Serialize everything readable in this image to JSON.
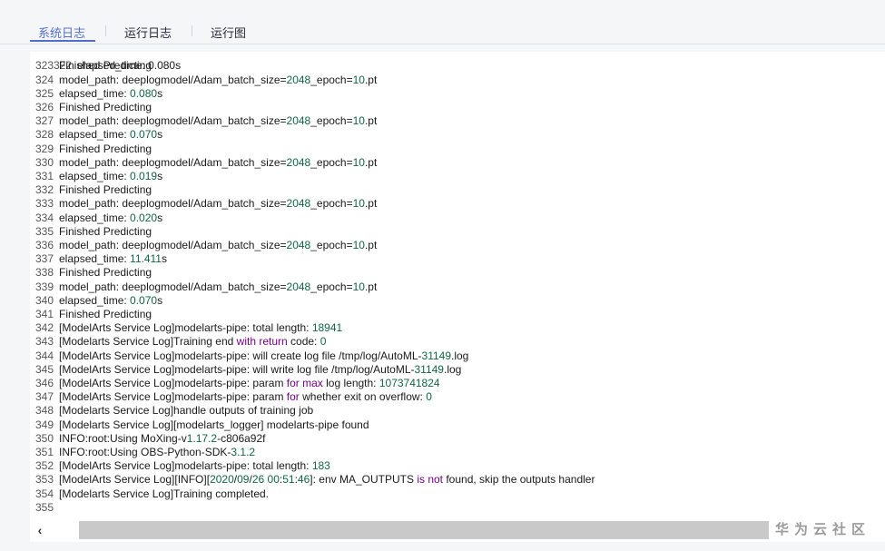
{
  "tabs": [
    {
      "label": "系统日志",
      "active": true
    },
    {
      "label": "运行日志",
      "active": false
    },
    {
      "label": "运行图",
      "active": false
    }
  ],
  "log": {
    "partial_top_line": "elapsed_time: 0.080s",
    "lines": [
      {
        "n": "323",
        "segs": [
          [
            "t",
            "Finished Predicting"
          ]
        ]
      },
      {
        "n": "324",
        "segs": [
          [
            "t",
            "model_path: deeplogmodel/Adam_batch_size="
          ],
          [
            "n",
            "2048"
          ],
          [
            "t",
            "_epoch="
          ],
          [
            "n",
            "10"
          ],
          [
            "t",
            ".pt"
          ]
        ]
      },
      {
        "n": "325",
        "segs": [
          [
            "t",
            "elapsed_time: "
          ],
          [
            "n",
            "0.080"
          ],
          [
            "t",
            "s"
          ]
        ]
      },
      {
        "n": "326",
        "segs": [
          [
            "t",
            "Finished Predicting"
          ]
        ]
      },
      {
        "n": "327",
        "segs": [
          [
            "t",
            "model_path: deeplogmodel/Adam_batch_size="
          ],
          [
            "n",
            "2048"
          ],
          [
            "t",
            "_epoch="
          ],
          [
            "n",
            "10"
          ],
          [
            "t",
            ".pt"
          ]
        ]
      },
      {
        "n": "328",
        "segs": [
          [
            "t",
            "elapsed_time: "
          ],
          [
            "n",
            "0.070"
          ],
          [
            "t",
            "s"
          ]
        ]
      },
      {
        "n": "329",
        "segs": [
          [
            "t",
            "Finished Predicting"
          ]
        ]
      },
      {
        "n": "330",
        "segs": [
          [
            "t",
            "model_path: deeplogmodel/Adam_batch_size="
          ],
          [
            "n",
            "2048"
          ],
          [
            "t",
            "_epoch="
          ],
          [
            "n",
            "10"
          ],
          [
            "t",
            ".pt"
          ]
        ]
      },
      {
        "n": "331",
        "segs": [
          [
            "t",
            "elapsed_time: "
          ],
          [
            "n",
            "0.019"
          ],
          [
            "t",
            "s"
          ]
        ]
      },
      {
        "n": "332",
        "segs": [
          [
            "t",
            "Finished Predicting"
          ]
        ]
      },
      {
        "n": "333",
        "segs": [
          [
            "t",
            "model_path: deeplogmodel/Adam_batch_size="
          ],
          [
            "n",
            "2048"
          ],
          [
            "t",
            "_epoch="
          ],
          [
            "n",
            "10"
          ],
          [
            "t",
            ".pt"
          ]
        ]
      },
      {
        "n": "334",
        "segs": [
          [
            "t",
            "elapsed_time: "
          ],
          [
            "n",
            "0.020"
          ],
          [
            "t",
            "s"
          ]
        ]
      },
      {
        "n": "335",
        "segs": [
          [
            "t",
            "Finished Predicting"
          ]
        ]
      },
      {
        "n": "336",
        "segs": [
          [
            "t",
            "model_path: deeplogmodel/Adam_batch_size="
          ],
          [
            "n",
            "2048"
          ],
          [
            "t",
            "_epoch="
          ],
          [
            "n",
            "10"
          ],
          [
            "t",
            ".pt"
          ]
        ]
      },
      {
        "n": "337",
        "segs": [
          [
            "t",
            "elapsed_time: "
          ],
          [
            "n",
            "11.411"
          ],
          [
            "t",
            "s"
          ]
        ]
      },
      {
        "n": "338",
        "segs": [
          [
            "t",
            "Finished Predicting"
          ]
        ]
      },
      {
        "n": "339",
        "segs": [
          [
            "t",
            "model_path: deeplogmodel/Adam_batch_size="
          ],
          [
            "n",
            "2048"
          ],
          [
            "t",
            "_epoch="
          ],
          [
            "n",
            "10"
          ],
          [
            "t",
            ".pt"
          ]
        ]
      },
      {
        "n": "340",
        "segs": [
          [
            "t",
            "elapsed_time: "
          ],
          [
            "n",
            "0.070"
          ],
          [
            "t",
            "s"
          ]
        ]
      },
      {
        "n": "341",
        "segs": [
          [
            "t",
            "Finished Predicting"
          ]
        ]
      },
      {
        "n": "342",
        "segs": [
          [
            "t",
            "[ModelArts Service Log]modelarts-pipe: total length: "
          ],
          [
            "n",
            "18941"
          ]
        ]
      },
      {
        "n": "343",
        "segs": [
          [
            "t",
            "[Modelarts Service Log]Training end "
          ],
          [
            "k",
            "with return"
          ],
          [
            "t",
            " code: "
          ],
          [
            "n",
            "0"
          ]
        ]
      },
      {
        "n": "344",
        "segs": [
          [
            "t",
            "[ModelArts Service Log]modelarts-pipe: will create log file /tmp/log/AutoML-"
          ],
          [
            "n",
            "31149"
          ],
          [
            "t",
            ".log"
          ]
        ]
      },
      {
        "n": "345",
        "segs": [
          [
            "t",
            "[ModelArts Service Log]modelarts-pipe: will write log file /tmp/log/AutoML-"
          ],
          [
            "n",
            "31149"
          ],
          [
            "t",
            ".log"
          ]
        ]
      },
      {
        "n": "346",
        "segs": [
          [
            "t",
            "[ModelArts Service Log]modelarts-pipe: param "
          ],
          [
            "k",
            "for max"
          ],
          [
            "t",
            " log length: "
          ],
          [
            "n",
            "1073741824"
          ]
        ]
      },
      {
        "n": "347",
        "segs": [
          [
            "t",
            "[ModelArts Service Log]modelarts-pipe: param "
          ],
          [
            "k",
            "for"
          ],
          [
            "t",
            " whether exit on overflow: "
          ],
          [
            "n",
            "0"
          ]
        ]
      },
      {
        "n": "348",
        "segs": [
          [
            "t",
            "[Modelarts Service Log]handle outputs of training job"
          ]
        ]
      },
      {
        "n": "349",
        "segs": [
          [
            "t",
            "[Modelarts Service Log][modelarts_logger] modelarts-pipe found"
          ]
        ]
      },
      {
        "n": "350",
        "segs": [
          [
            "t",
            "INFO:root:Using MoXing-v"
          ],
          [
            "n",
            "1.17.2"
          ],
          [
            "t",
            "-c806a92f"
          ]
        ]
      },
      {
        "n": "351",
        "segs": [
          [
            "t",
            "INFO:root:Using OBS-Python-SDK-"
          ],
          [
            "n",
            "3.1.2"
          ]
        ]
      },
      {
        "n": "352",
        "segs": [
          [
            "t",
            "[ModelArts Service Log]modelarts-pipe: total length: "
          ],
          [
            "n",
            "183"
          ]
        ]
      },
      {
        "n": "353",
        "segs": [
          [
            "t",
            "[ModelArts Service Log][INFO]["
          ],
          [
            "n",
            "2020"
          ],
          [
            "t",
            "/"
          ],
          [
            "n",
            "09"
          ],
          [
            "t",
            "/"
          ],
          [
            "n",
            "26"
          ],
          [
            "t",
            " "
          ],
          [
            "n",
            "00"
          ],
          [
            "t",
            ":"
          ],
          [
            "n",
            "51"
          ],
          [
            "t",
            ":"
          ],
          [
            "n",
            "46"
          ],
          [
            "t",
            "]: env MA_OUTPUTS "
          ],
          [
            "k",
            "is not"
          ],
          [
            "t",
            " found, skip the outputs handler"
          ]
        ]
      },
      {
        "n": "354",
        "segs": [
          [
            "t",
            "[Modelarts Service Log]Training completed."
          ]
        ]
      },
      {
        "n": "355",
        "segs": []
      }
    ]
  },
  "scrollbar": {
    "left_arrow_icon": "chevron-left-icon",
    "left_arrow_glyph": "‹"
  },
  "watermark": "华为云社区",
  "colors": {
    "accent": "#526ecc",
    "number": "#116644",
    "keyword": "#770088"
  }
}
